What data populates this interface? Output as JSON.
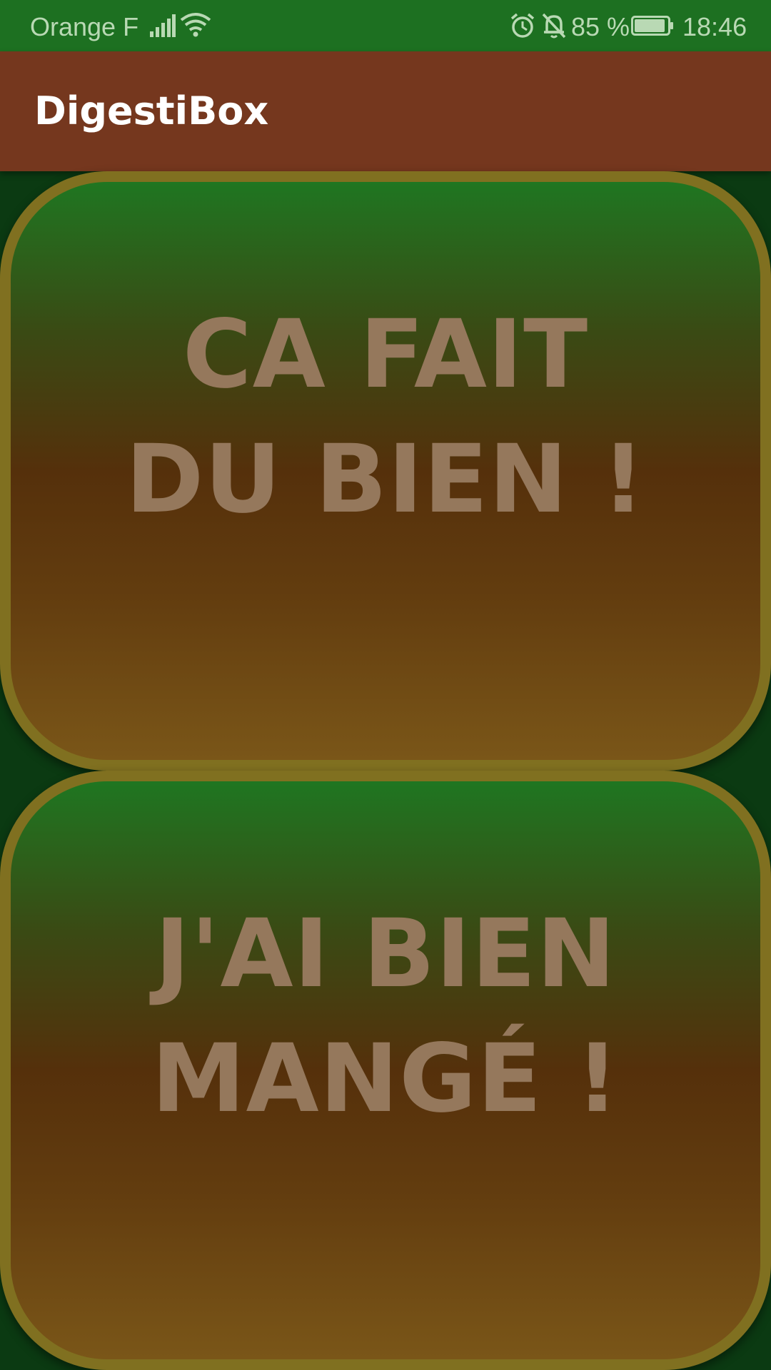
{
  "status_bar": {
    "carrier": "Orange F",
    "battery_percent": "85 %",
    "time": "18:46",
    "icons": [
      "signal-icon",
      "wifi-icon",
      "alarm-icon",
      "bell-off-icon",
      "battery-icon"
    ]
  },
  "app_bar": {
    "title": "DigestiBox"
  },
  "buttons": [
    {
      "label": "CA FAIT DU BIEN !"
    },
    {
      "label": "J'AI BIEN MANGÉ !"
    }
  ],
  "colors": {
    "status_bar": "#1d7021",
    "app_bar": "#75371e",
    "button_border": "#807020",
    "button_text": "#95785c",
    "background": "#0b3a12"
  }
}
